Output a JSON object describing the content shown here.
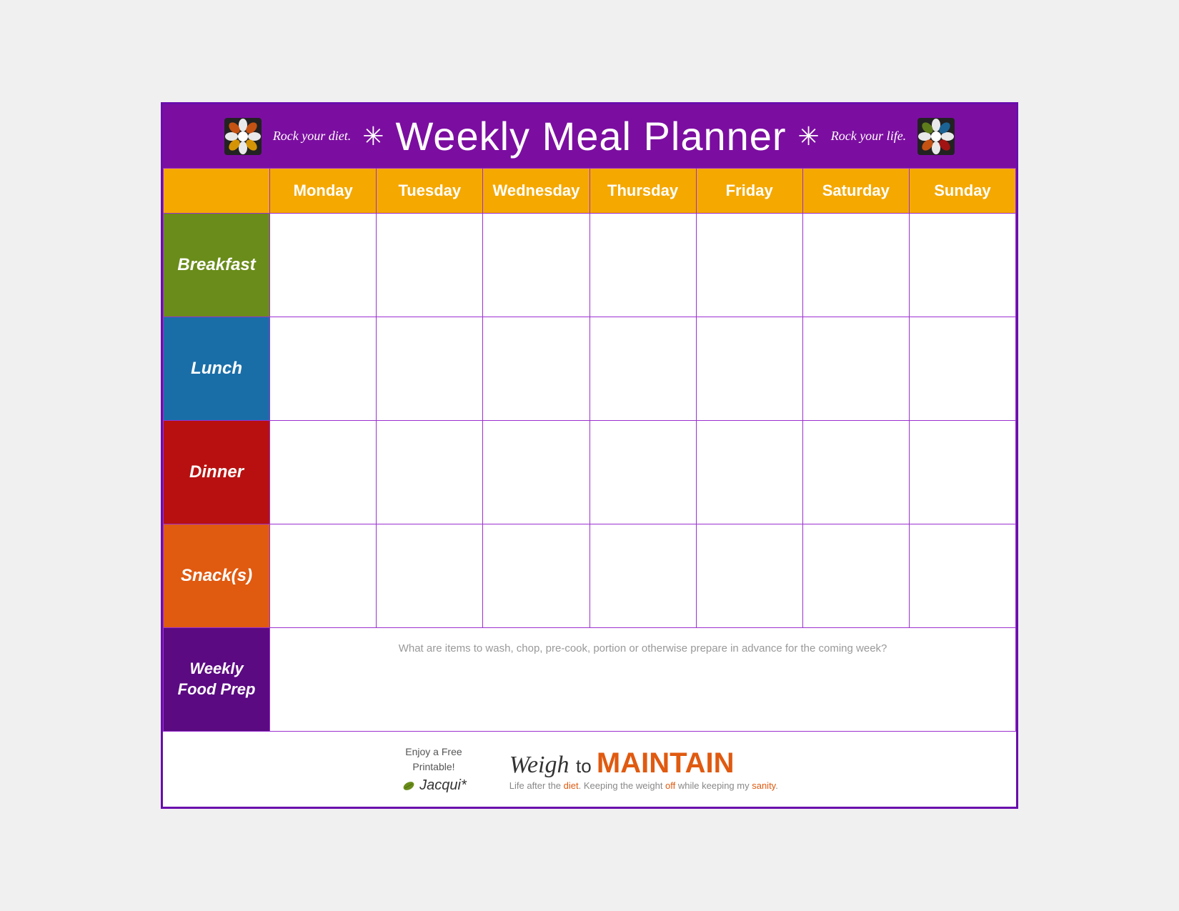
{
  "header": {
    "title": "Weekly Meal Planner",
    "tagline_left": "Rock your diet.",
    "tagline_right": "Rock your life.",
    "asterisk": "✳"
  },
  "days": {
    "empty": "",
    "monday": "Monday",
    "tuesday": "Tuesday",
    "wednesday": "Wednesday",
    "thursday": "Thursday",
    "friday": "Friday",
    "saturday": "Saturday",
    "sunday": "Sunday"
  },
  "rows": {
    "breakfast": "Breakfast",
    "lunch": "Lunch",
    "dinner": "Dinner",
    "snacks": "Snack(s)",
    "weekly_line1": "Weekly",
    "weekly_line2": "Food Prep"
  },
  "weekly_prep_placeholder": "What are items to wash, chop, pre-cook, portion or otherwise prepare in advance for the coming week?",
  "footer": {
    "enjoy_line1": "Enjoy a Free",
    "enjoy_line2": "Printable!",
    "signature": "Jacqui*",
    "brand_weigh": "Weigh",
    "brand_to": " to ",
    "brand_maintain": "MAINTAIN",
    "tagline": "Life after the diet. Keeping the weight off while keeping my sanity."
  },
  "colors": {
    "header_bg": "#7b0ea0",
    "day_header_bg": "#f5a800",
    "breakfast_bg": "#6a8c1a",
    "lunch_bg": "#1a6ea8",
    "dinner_bg": "#b81010",
    "snacks_bg": "#e05a10",
    "weekly_bg": "#5b0a82",
    "border": "#9b30d0"
  }
}
